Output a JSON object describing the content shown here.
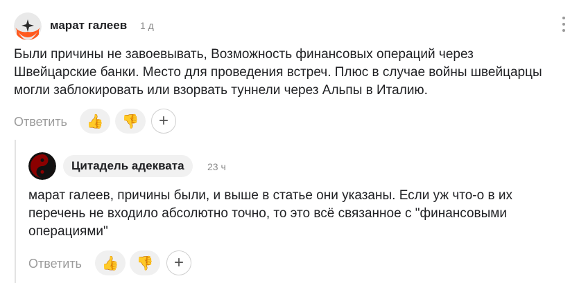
{
  "comment": {
    "author": "марат галеев",
    "time": "1 д",
    "text": "Были причины не завоевывать, Возможность финансовых операций через\nШвейцарские банки. Место для проведения встреч. Плюс в случае войны швейцарцы\nмогли заблокировать или взорвать туннели через Альпы в Италию.",
    "reply_label": "Ответить",
    "like_icon": "👍",
    "dislike_icon": "👎",
    "plus_label": "+"
  },
  "reply": {
    "author": "Цитадель адеквата",
    "time": "23 ч",
    "text": "марат галеев, причины были, и выше в статье они указаны. Если уж что-о в их\nперечень не входило абсолютно точно, то это всё связанное с \"финансовыми\nоперациями\"",
    "reply_label": "Ответить",
    "like_icon": "👍",
    "dislike_icon": "👎",
    "plus_label": "+"
  },
  "colors": {
    "avatar1_bg": "#2b2b2b",
    "avatar1_accent": "#ff5a1f",
    "avatar2_bg": "#8b0000",
    "chip_bg": "#f1f1f1"
  }
}
